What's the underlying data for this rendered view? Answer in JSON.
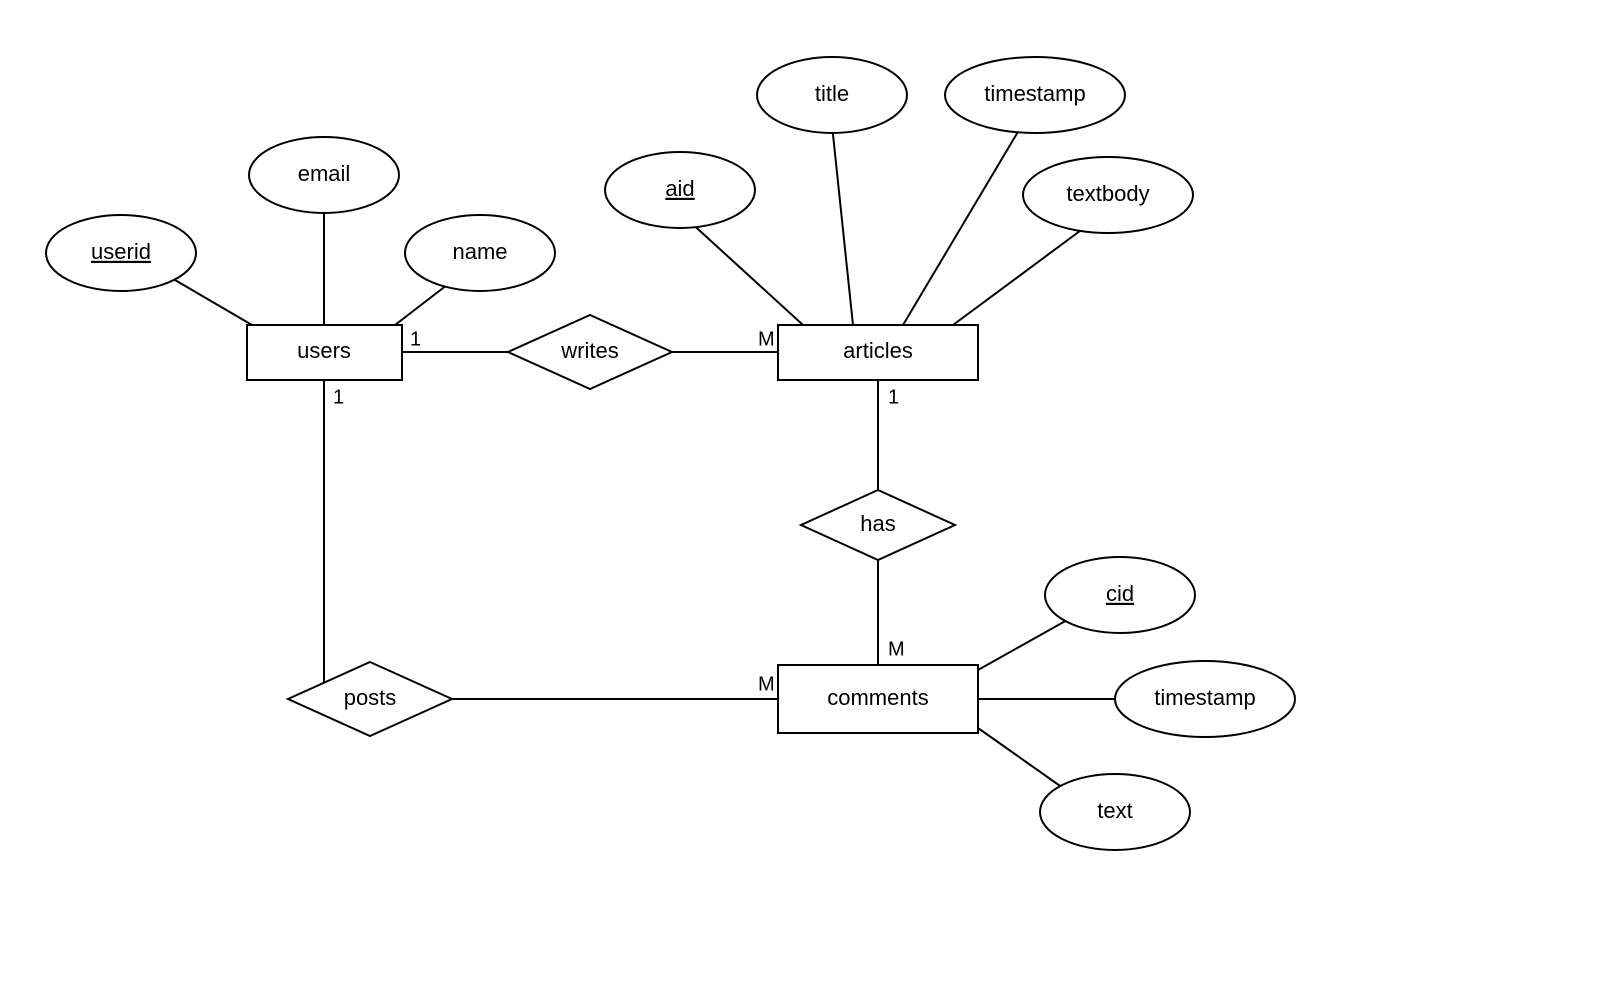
{
  "entities": {
    "users": {
      "label": "users",
      "attributes": {
        "userid": {
          "label": "userid",
          "pk": true
        },
        "email": {
          "label": "email",
          "pk": false
        },
        "name": {
          "label": "name",
          "pk": false
        }
      }
    },
    "articles": {
      "label": "articles",
      "attributes": {
        "aid": {
          "label": "aid",
          "pk": true
        },
        "title": {
          "label": "title",
          "pk": false
        },
        "timestamp": {
          "label": "timestamp",
          "pk": false
        },
        "textbody": {
          "label": "textbody",
          "pk": false
        }
      }
    },
    "comments": {
      "label": "comments",
      "attributes": {
        "cid": {
          "label": "cid",
          "pk": true
        },
        "timestamp": {
          "label": "timestamp",
          "pk": false
        },
        "text": {
          "label": "text",
          "pk": false
        }
      }
    }
  },
  "relationships": {
    "writes": {
      "label": "writes",
      "between": [
        "users",
        "articles"
      ],
      "cardinality": {
        "users": "1",
        "articles": "M"
      }
    },
    "has": {
      "label": "has",
      "between": [
        "articles",
        "comments"
      ],
      "cardinality": {
        "articles": "1",
        "comments": "M"
      }
    },
    "posts": {
      "label": "posts",
      "between": [
        "users",
        "comments"
      ],
      "cardinality": {
        "users": "1",
        "comments": "M"
      }
    }
  }
}
